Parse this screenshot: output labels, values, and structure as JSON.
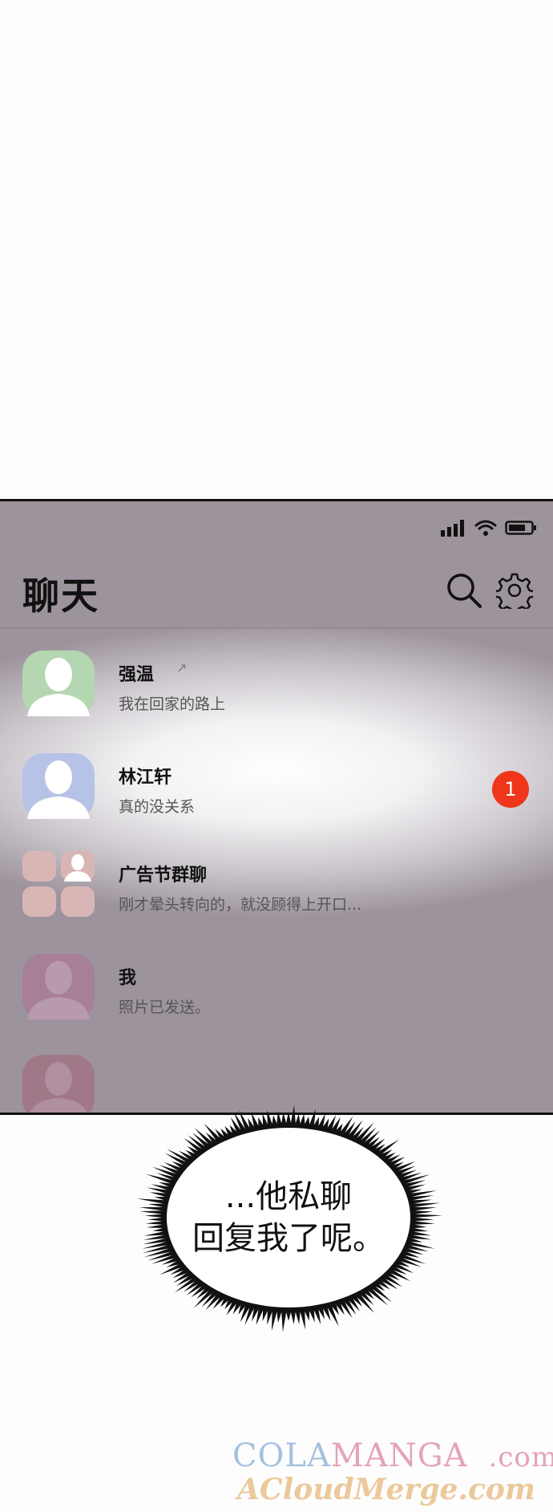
{
  "header": {
    "title": "聊天"
  },
  "chats": [
    {
      "name": "强温",
      "preview": "我在回家的路上",
      "pin": "↗",
      "avatar_color": "#b4d6b0"
    },
    {
      "name": "林江轩",
      "preview": "真的没关系",
      "badge": "1",
      "avatar_color": "#b7c3e6"
    },
    {
      "name": "广告节群聊",
      "preview": "刚才晕头转向的，就没顾得上开口...",
      "avatar_color": "#d9b6b6"
    },
    {
      "name": "我",
      "preview": "照片已发送。",
      "avatar_color": "#a77f97"
    }
  ],
  "bubble": {
    "line1": "...他私聊",
    "line2": "回复我了呢。"
  },
  "watermark": {
    "part1": "COLA",
    "part2": "MANGA",
    "part3": ".com",
    "line2": "ACloudMerge.com"
  },
  "colors": {
    "badge": "#f0361a",
    "phone_bg_dark": "#9d939c"
  }
}
